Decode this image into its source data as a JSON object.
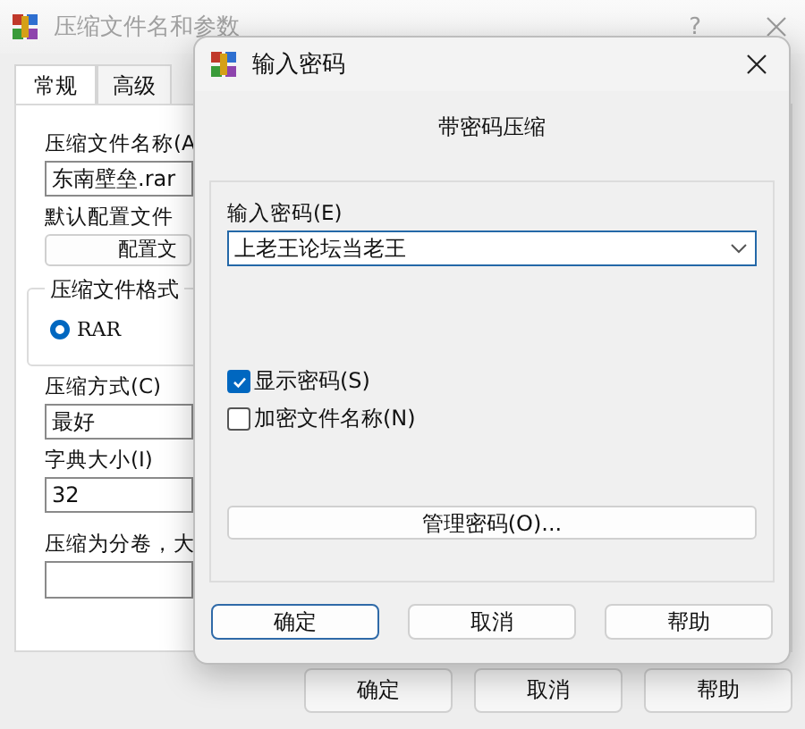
{
  "main_window": {
    "title": "压缩文件名和参数",
    "help": "?",
    "tabs": [
      {
        "label": "常规",
        "selected": true
      },
      {
        "label": "高级",
        "selected": false
      }
    ],
    "general": {
      "archive_name_label": "压缩文件名称(A",
      "archive_name_value": "东南壁垒.rar",
      "profile_label": "默认配置文件",
      "profile_button": "配置文",
      "format_group_label": "压缩文件格式",
      "formats": [
        {
          "label": "RAR",
          "selected": true
        }
      ],
      "method_label": "压缩方式(C)",
      "method_value": "最好",
      "dictionary_label": "字典大小(I)",
      "dictionary_value": "32",
      "split_label": "压缩为分卷，大"
    },
    "buttons": [
      {
        "label": "确定"
      },
      {
        "label": "取消"
      },
      {
        "label": "帮助"
      }
    ]
  },
  "password_dialog": {
    "title": "输入密码",
    "heading": "带密码压缩",
    "password_label": "输入密码(E)",
    "password_value": "上老王论坛当老王",
    "options": [
      {
        "label": "显示密码(S)",
        "checked": true
      },
      {
        "label": "加密文件名称(N)",
        "checked": false
      }
    ],
    "manage_button": "管理密码(O)...",
    "buttons": [
      {
        "label": "确定",
        "default": true
      },
      {
        "label": "取消",
        "default": false
      },
      {
        "label": "帮助",
        "default": false
      }
    ]
  }
}
